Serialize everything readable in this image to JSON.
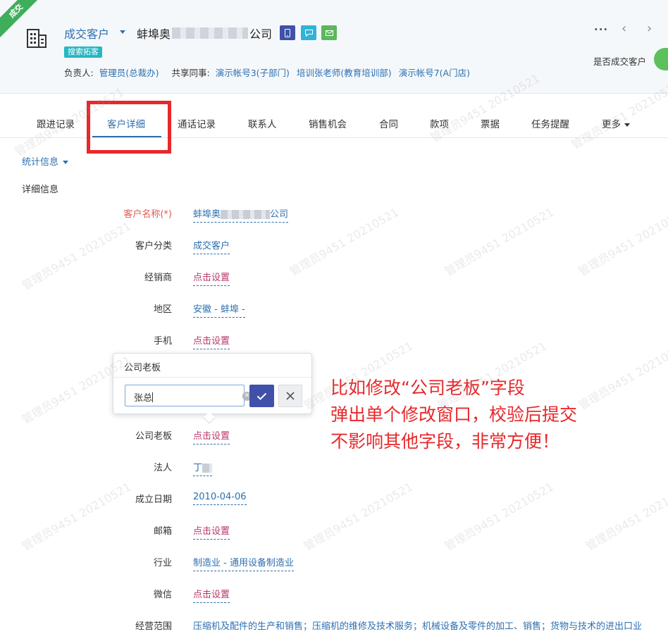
{
  "header": {
    "corner_ribbon": "成交",
    "customer_type": "成交客户",
    "customer_name_prefix": "蚌埠奥",
    "customer_name_suffix": "公司",
    "tag_search": "搜索拓客",
    "owner_label": "负责人:",
    "owner_value": "管理员(总裁办)",
    "share_label": "共享同事:",
    "share_users": [
      "演示帐号3(子部门)",
      "培训张老师(教育培训部)",
      "演示帐号7(A门店)"
    ],
    "more_glyph": "···",
    "prev_glyph": "‹",
    "next_glyph": "›",
    "deal_label": "是否成交客户"
  },
  "tabs": [
    "跟进记录",
    "客户详细",
    "通话记录",
    "联系人",
    "销售机会",
    "合同",
    "款项",
    "票据",
    "任务提醒",
    "更多"
  ],
  "active_tab": "客户详细",
  "sections": {
    "stats_toggle": "统计信息",
    "detail_heading": "详细信息"
  },
  "fields": [
    {
      "label": "客户名称(*)",
      "value_prefix": "蚌埠奥",
      "value_suffix": "公司"
    },
    {
      "label": "客户分类",
      "value": "成交客户"
    },
    {
      "label": "经销商",
      "value": "点击设置"
    },
    {
      "label": "地区",
      "value": "安徽 - 蚌埠 -"
    },
    {
      "label": "手机",
      "value": "点击设置"
    },
    {
      "label": "公司老板",
      "value": "点击设置"
    },
    {
      "label": "法人",
      "value": "丁"
    },
    {
      "label": "成立日期",
      "value": "2010-04-06"
    },
    {
      "label": "邮箱",
      "value": "点击设置"
    },
    {
      "label": "行业",
      "value": "制造业 - 通用设备制造业"
    },
    {
      "label": "微信",
      "value": "点击设置"
    },
    {
      "label": "经营范围",
      "value": "压缩机及配件的生产和销售；压缩机的维修及技术服务；机械设备及零件的加工、销售；货物与技术的进出口业"
    }
  ],
  "popover": {
    "title": "公司老板",
    "input_value": "张总",
    "clear_glyph": "✕"
  },
  "annotation": {
    "lines": [
      "比如修改“公司老板”字段",
      "弹出单个修改窗口，校验后提交",
      "不影响其他字段，非常方便！"
    ]
  },
  "watermark": "管理员9451 20210521",
  "colors": {
    "link_blue": "#2c6fb0",
    "unset_red": "#b83a6b",
    "highlight_red": "#e8282b",
    "confirm_indigo": "#3f51a8",
    "ribbon_green": "#3fae5a"
  }
}
